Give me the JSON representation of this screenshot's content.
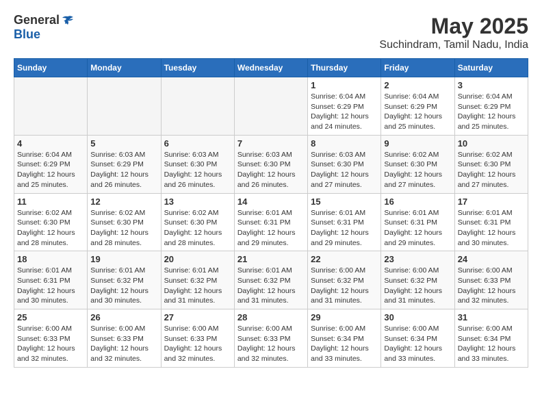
{
  "logo": {
    "general": "General",
    "blue": "Blue"
  },
  "title": "May 2025",
  "subtitle": "Suchindram, Tamil Nadu, India",
  "days_of_week": [
    "Sunday",
    "Monday",
    "Tuesday",
    "Wednesday",
    "Thursday",
    "Friday",
    "Saturday"
  ],
  "weeks": [
    [
      {
        "day": "",
        "content": ""
      },
      {
        "day": "",
        "content": ""
      },
      {
        "day": "",
        "content": ""
      },
      {
        "day": "",
        "content": ""
      },
      {
        "day": "1",
        "content": "Sunrise: 6:04 AM\nSunset: 6:29 PM\nDaylight: 12 hours\nand 24 minutes."
      },
      {
        "day": "2",
        "content": "Sunrise: 6:04 AM\nSunset: 6:29 PM\nDaylight: 12 hours\nand 25 minutes."
      },
      {
        "day": "3",
        "content": "Sunrise: 6:04 AM\nSunset: 6:29 PM\nDaylight: 12 hours\nand 25 minutes."
      }
    ],
    [
      {
        "day": "4",
        "content": "Sunrise: 6:04 AM\nSunset: 6:29 PM\nDaylight: 12 hours\nand 25 minutes."
      },
      {
        "day": "5",
        "content": "Sunrise: 6:03 AM\nSunset: 6:29 PM\nDaylight: 12 hours\nand 26 minutes."
      },
      {
        "day": "6",
        "content": "Sunrise: 6:03 AM\nSunset: 6:30 PM\nDaylight: 12 hours\nand 26 minutes."
      },
      {
        "day": "7",
        "content": "Sunrise: 6:03 AM\nSunset: 6:30 PM\nDaylight: 12 hours\nand 26 minutes."
      },
      {
        "day": "8",
        "content": "Sunrise: 6:03 AM\nSunset: 6:30 PM\nDaylight: 12 hours\nand 27 minutes."
      },
      {
        "day": "9",
        "content": "Sunrise: 6:02 AM\nSunset: 6:30 PM\nDaylight: 12 hours\nand 27 minutes."
      },
      {
        "day": "10",
        "content": "Sunrise: 6:02 AM\nSunset: 6:30 PM\nDaylight: 12 hours\nand 27 minutes."
      }
    ],
    [
      {
        "day": "11",
        "content": "Sunrise: 6:02 AM\nSunset: 6:30 PM\nDaylight: 12 hours\nand 28 minutes."
      },
      {
        "day": "12",
        "content": "Sunrise: 6:02 AM\nSunset: 6:30 PM\nDaylight: 12 hours\nand 28 minutes."
      },
      {
        "day": "13",
        "content": "Sunrise: 6:02 AM\nSunset: 6:30 PM\nDaylight: 12 hours\nand 28 minutes."
      },
      {
        "day": "14",
        "content": "Sunrise: 6:01 AM\nSunset: 6:31 PM\nDaylight: 12 hours\nand 29 minutes."
      },
      {
        "day": "15",
        "content": "Sunrise: 6:01 AM\nSunset: 6:31 PM\nDaylight: 12 hours\nand 29 minutes."
      },
      {
        "day": "16",
        "content": "Sunrise: 6:01 AM\nSunset: 6:31 PM\nDaylight: 12 hours\nand 29 minutes."
      },
      {
        "day": "17",
        "content": "Sunrise: 6:01 AM\nSunset: 6:31 PM\nDaylight: 12 hours\nand 30 minutes."
      }
    ],
    [
      {
        "day": "18",
        "content": "Sunrise: 6:01 AM\nSunset: 6:31 PM\nDaylight: 12 hours\nand 30 minutes."
      },
      {
        "day": "19",
        "content": "Sunrise: 6:01 AM\nSunset: 6:32 PM\nDaylight: 12 hours\nand 30 minutes."
      },
      {
        "day": "20",
        "content": "Sunrise: 6:01 AM\nSunset: 6:32 PM\nDaylight: 12 hours\nand 31 minutes."
      },
      {
        "day": "21",
        "content": "Sunrise: 6:01 AM\nSunset: 6:32 PM\nDaylight: 12 hours\nand 31 minutes."
      },
      {
        "day": "22",
        "content": "Sunrise: 6:00 AM\nSunset: 6:32 PM\nDaylight: 12 hours\nand 31 minutes."
      },
      {
        "day": "23",
        "content": "Sunrise: 6:00 AM\nSunset: 6:32 PM\nDaylight: 12 hours\nand 31 minutes."
      },
      {
        "day": "24",
        "content": "Sunrise: 6:00 AM\nSunset: 6:33 PM\nDaylight: 12 hours\nand 32 minutes."
      }
    ],
    [
      {
        "day": "25",
        "content": "Sunrise: 6:00 AM\nSunset: 6:33 PM\nDaylight: 12 hours\nand 32 minutes."
      },
      {
        "day": "26",
        "content": "Sunrise: 6:00 AM\nSunset: 6:33 PM\nDaylight: 12 hours\nand 32 minutes."
      },
      {
        "day": "27",
        "content": "Sunrise: 6:00 AM\nSunset: 6:33 PM\nDaylight: 12 hours\nand 32 minutes."
      },
      {
        "day": "28",
        "content": "Sunrise: 6:00 AM\nSunset: 6:33 PM\nDaylight: 12 hours\nand 32 minutes."
      },
      {
        "day": "29",
        "content": "Sunrise: 6:00 AM\nSunset: 6:34 PM\nDaylight: 12 hours\nand 33 minutes."
      },
      {
        "day": "30",
        "content": "Sunrise: 6:00 AM\nSunset: 6:34 PM\nDaylight: 12 hours\nand 33 minutes."
      },
      {
        "day": "31",
        "content": "Sunrise: 6:00 AM\nSunset: 6:34 PM\nDaylight: 12 hours\nand 33 minutes."
      }
    ]
  ]
}
